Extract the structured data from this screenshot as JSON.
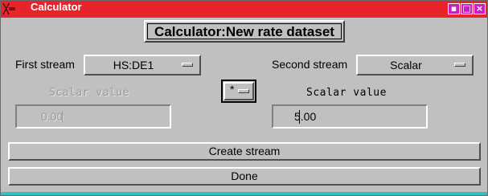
{
  "window": {
    "title": "Calculator",
    "titlebar_icon": "tool-icon",
    "controls": [
      "minimize-icon",
      "maximize-icon",
      "close-icon"
    ],
    "titlebar_color": "#e8242a"
  },
  "header": {
    "title": "Calculator:New rate dataset"
  },
  "first_stream": {
    "label": "First stream",
    "value": "HS:DE1"
  },
  "second_stream": {
    "label": "Second stream",
    "value": "Scalar"
  },
  "operator": {
    "value": "*"
  },
  "left_scalar": {
    "label": "Scalar value",
    "value": "0.00",
    "enabled": false
  },
  "right_scalar": {
    "label": "Scalar value",
    "value": "5.00",
    "enabled": true
  },
  "buttons": {
    "create": "Create stream",
    "done": "Done"
  }
}
